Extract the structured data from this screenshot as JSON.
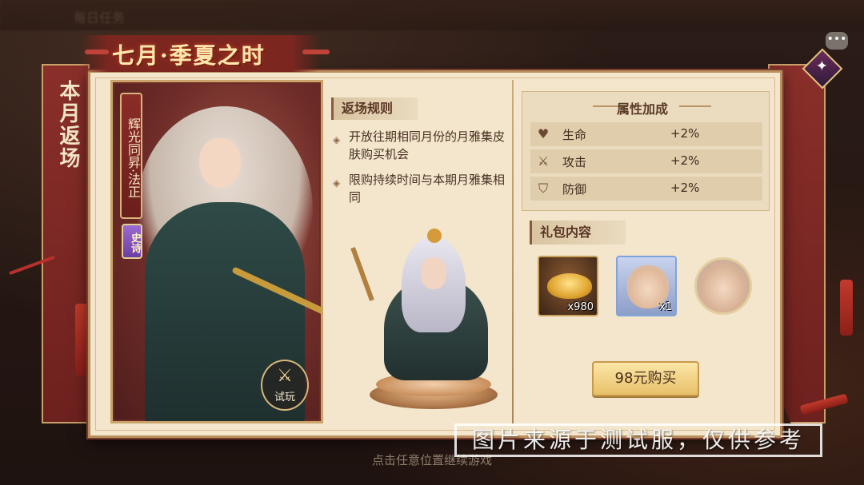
{
  "background": {
    "top_text_left": "每日任务"
  },
  "event": {
    "title": "七月·季夏之时",
    "side_label": "本月返场"
  },
  "character_card": {
    "name_tag": "辉光同昇·法正",
    "rarity": "史诗",
    "trial_label": "试玩",
    "trial_icon": "crossed-swords-icon"
  },
  "rules": {
    "header": "返场规则",
    "items": [
      "开放往期相同月份的月雅集皮肤购买机会",
      "限购持续时间与本期月雅集相同"
    ]
  },
  "attributes": {
    "title": "属性加成",
    "rows": [
      {
        "icon": "heart-icon",
        "name": "生命",
        "value": "+2%"
      },
      {
        "icon": "sword-icon",
        "name": "攻击",
        "value": "+2%"
      },
      {
        "icon": "shield-icon",
        "name": "防御",
        "value": "+2%"
      }
    ]
  },
  "gift": {
    "header": "礼包内容",
    "items": [
      {
        "type": "gold-ingot",
        "count": "x980"
      },
      {
        "type": "skin-portrait",
        "count": "x1"
      },
      {
        "type": "avatar-frame",
        "count": ""
      }
    ],
    "buy_label": "98元购买"
  },
  "footer": {
    "hint": "点击任意位置继续游戏",
    "watermark": "图片来源于测试服，仅供参考"
  },
  "colors": {
    "accent_red": "#7c2620",
    "parchment": "#f3e6cc",
    "gold": "#c9a36b"
  }
}
